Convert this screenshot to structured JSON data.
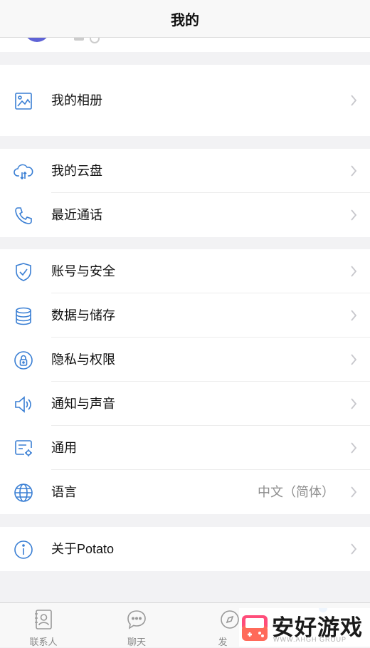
{
  "header": {
    "title": "我的"
  },
  "groups": [
    {
      "items": [
        {
          "label": "我的相册",
          "icon": "photo-album-icon"
        }
      ]
    },
    {
      "items": [
        {
          "label": "我的云盘",
          "icon": "cloud-drive-icon"
        },
        {
          "label": "最近通话",
          "icon": "phone-icon"
        }
      ]
    },
    {
      "items": [
        {
          "label": "账号与安全",
          "icon": "shield-icon"
        },
        {
          "label": "数据与储存",
          "icon": "database-icon"
        },
        {
          "label": "隐私与权限",
          "icon": "lock-icon"
        },
        {
          "label": "通知与声音",
          "icon": "speaker-icon"
        },
        {
          "label": "通用",
          "icon": "settings-card-icon"
        },
        {
          "label": "语言",
          "icon": "globe-icon",
          "value": "中文（简体）"
        }
      ]
    },
    {
      "items": [
        {
          "label": "关于Potato",
          "icon": "info-icon"
        }
      ]
    }
  ],
  "tabbar": {
    "tabs": [
      {
        "label": "联系人",
        "icon": "contacts-icon"
      },
      {
        "label": "聊天",
        "icon": "chat-icon"
      },
      {
        "label": "发",
        "icon": "discover-icon"
      }
    ]
  },
  "watermark": {
    "title": "安好游戏",
    "subtitle": "WWW.AHGH GROUP"
  },
  "colors": {
    "accent": "#2f7de1",
    "icon": "#3a7fd4",
    "chevron": "#c7c7cc"
  }
}
